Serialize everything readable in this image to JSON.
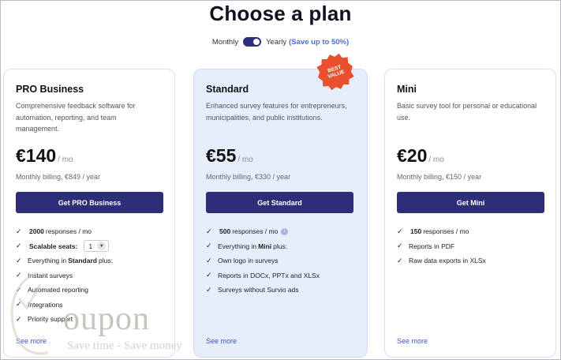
{
  "header": {
    "title": "Choose a plan",
    "monthly_label": "Monthly",
    "yearly_label": "Yearly",
    "save_note": "(Save up to 50%)"
  },
  "plans": [
    {
      "name": "PRO Business",
      "description": "Comprehensive feedback software for automation, reporting, and team management.",
      "price": "€140",
      "per": "/ mo",
      "billing_note": "Monthly billing, €849 / year",
      "cta": "Get PRO Business",
      "features": {
        "f1_bold": "2000",
        "f1_rest": "responses / mo",
        "f2_bold": "Scalable seats:",
        "seats_value": "1",
        "f3_pre": "Everything in",
        "f3_bold": "Standard",
        "f3_post": "plus:",
        "f4": "Instant surveys",
        "f5": "Automated reporting",
        "f6": "Integrations",
        "f7": "Priority support"
      },
      "see_more": "See more"
    },
    {
      "name": "Standard",
      "description": "Enhanced survey features for entrepreneurs, municipalities, and public institutions.",
      "price": "€55",
      "per": "/ mo",
      "billing_note": "Monthly billing, €330 / year",
      "cta": "Get Standard",
      "badge": "BEST VALUE",
      "features": {
        "f1_bold": "500",
        "f1_rest": "responses / mo",
        "f2_pre": "Everything in",
        "f2_bold": "Mini",
        "f2_post": "plus:",
        "f3": "Own logo in surveys",
        "f4": "Reports in DOCx, PPTx and XLSx",
        "f5": "Surveys without Survio ads"
      },
      "see_more": "See more"
    },
    {
      "name": "Mini",
      "description": "Basic survey tool for personal or educational use.",
      "price": "€20",
      "per": "/ mo",
      "billing_note": "Monthly billing, €150 / year",
      "cta": "Get Mini",
      "features": {
        "f1_bold": "150",
        "f1_rest": "responses / mo",
        "f2": "Reports in PDF",
        "f3": "Raw data exports in XLSx"
      },
      "see_more": "See more"
    }
  ],
  "watermark": {
    "text": "oupon",
    "sub": "Save time - Save money"
  },
  "colors": {
    "accent": "#2e2d78",
    "link": "#3d57b8",
    "badge": "#e8502e",
    "save_note": "#4a6ee0",
    "highlight_card": "#e6eefc"
  }
}
